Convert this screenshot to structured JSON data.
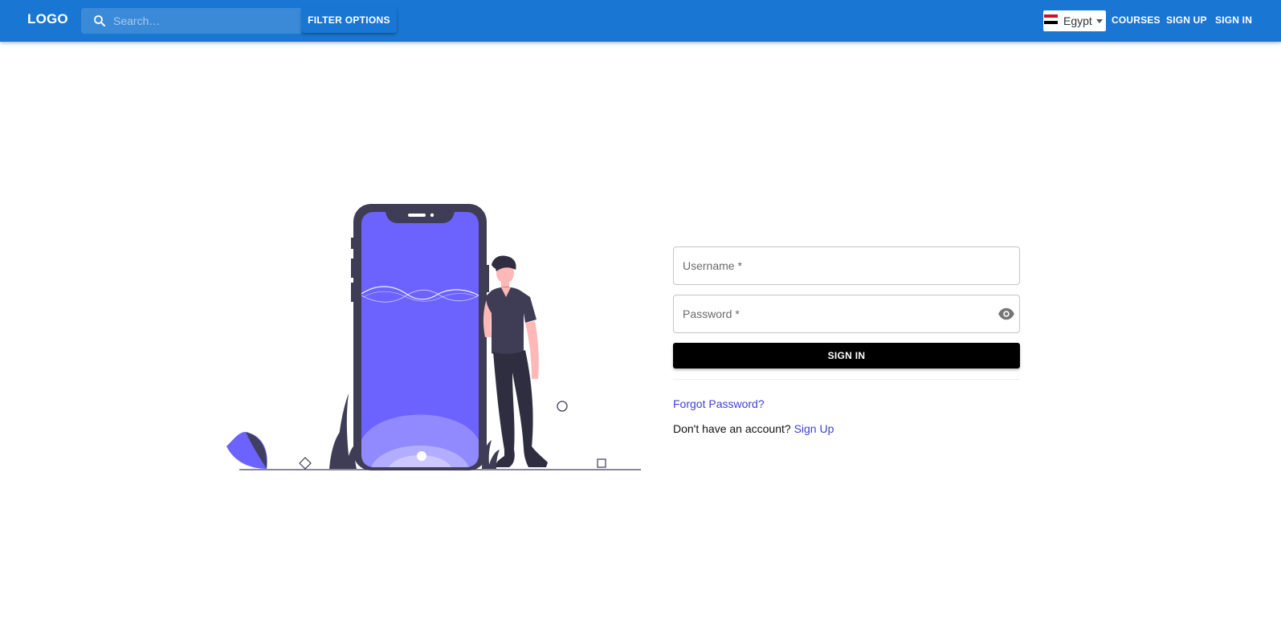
{
  "header": {
    "logo": "LOGO",
    "search_placeholder": "Search…",
    "filter_label": "FILTER OPTIONS",
    "country": "Egypt",
    "nav": {
      "courses": "COURSES",
      "sign_up": "SIGN UP",
      "sign_in": "SIGN IN"
    }
  },
  "form": {
    "username_placeholder": "Username *",
    "password_placeholder": "Password *",
    "submit_label": "SIGN IN",
    "forgot_label": "Forgot Password?",
    "no_account_text": "Don't have an account?",
    "signup_link": "Sign Up"
  },
  "colors": {
    "appbar": "#1976d2",
    "accent": "#6c63ff",
    "link": "#3f3fd6",
    "button": "#000000"
  },
  "icons": [
    "search-icon",
    "egypt-flag-icon",
    "chevron-down-icon",
    "eye-icon"
  ]
}
